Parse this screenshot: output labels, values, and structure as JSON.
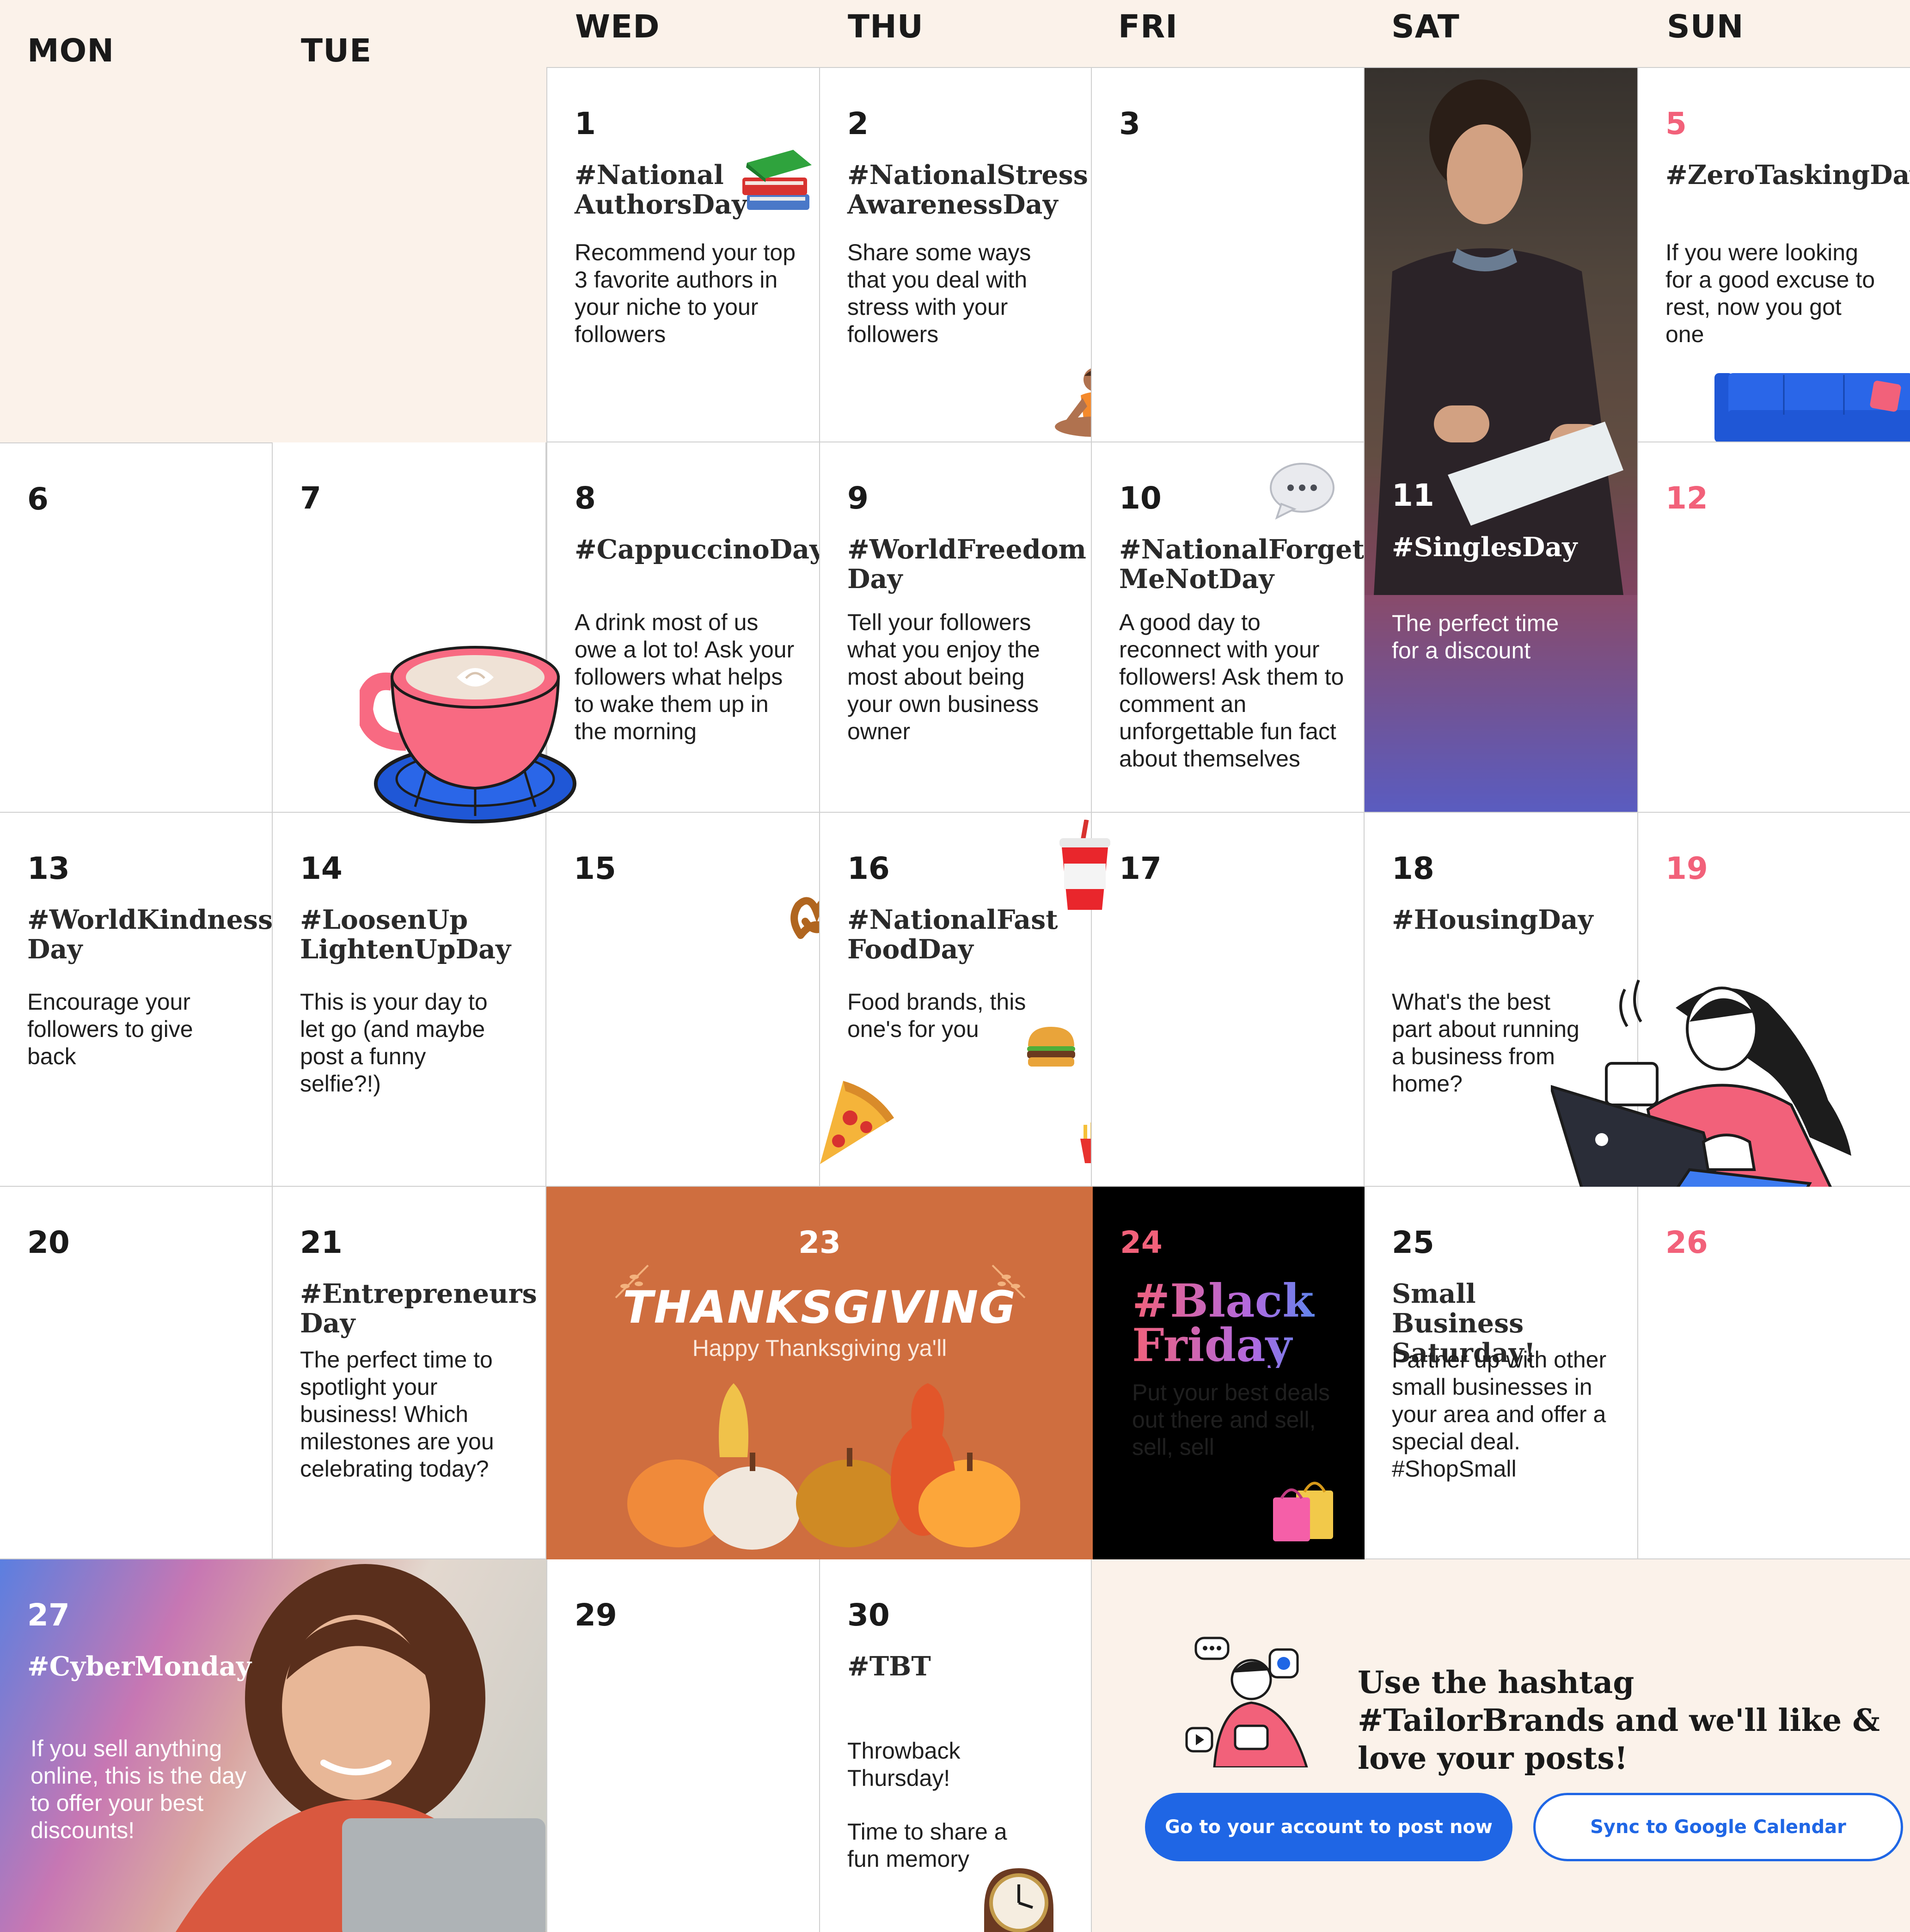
{
  "weekdays": [
    "MON",
    "TUE",
    "WED",
    "THU",
    "FRI",
    "SAT",
    "SUN"
  ],
  "days": {
    "d1": {
      "num": "1",
      "tag": "#National AuthorsDay",
      "desc": "Recommend your top 3 favorite authors in your niche to your followers",
      "icon": "books-icon"
    },
    "d2": {
      "num": "2",
      "tag": "#NationalStress AwarenessDay",
      "desc": "Share some ways that you deal with stress with your followers",
      "icon": "meditation-icon"
    },
    "d3": {
      "num": "3"
    },
    "d5": {
      "num": "5",
      "tag": "#ZeroTaskingDay",
      "desc": "If you were looking for a good excuse to rest, now you got one",
      "icon": "sofa-icon"
    },
    "d6": {
      "num": "6"
    },
    "d7": {
      "num": "7",
      "icon": "cappuccino-icon"
    },
    "d8": {
      "num": "8",
      "tag": "#CappuccinoDay",
      "desc": "A drink most of us owe a lot to! Ask your followers what helps to wake them up in the morning"
    },
    "d9": {
      "num": "9",
      "tag": "#WorldFreedom Day",
      "desc": "Tell your followers what you enjoy the most about being your own business owner"
    },
    "d10": {
      "num": "10",
      "tag": "#NationalForget MeNotDay",
      "desc": "A good day to reconnect with your followers! Ask them to comment an unforgettable fun fact about themselves",
      "icon": "speech-bubble-icon"
    },
    "d11": {
      "num": "11",
      "tag": "#SinglesDay",
      "desc": "The perfect time for a discount",
      "photo": "man-reading-letter-photo"
    },
    "d12": {
      "num": "12"
    },
    "d13": {
      "num": "13",
      "tag": "#WorldKindness Day",
      "desc": "Encourage your followers to give back"
    },
    "d14": {
      "num": "14",
      "tag": "#LoosenUp LightenUpDay",
      "desc": "This is your day to let go (and maybe post a funny selfie?!)"
    },
    "d15": {
      "num": "15",
      "icon": "pretzel-icon"
    },
    "d16": {
      "num": "16",
      "tag": "#NationalFast FoodDay",
      "desc": "Food brands, this one's for you",
      "icons": [
        "soda-cup-icon",
        "burger-icon",
        "pizza-icon",
        "fries-icon"
      ]
    },
    "d17": {
      "num": "17"
    },
    "d18": {
      "num": "18",
      "tag": "#HousingDay",
      "desc": "What's the best part about running a business from home?",
      "icon": "woman-with-laptop-icon"
    },
    "d19": {
      "num": "19"
    },
    "d20": {
      "num": "20"
    },
    "d21": {
      "num": "21",
      "tag": "#Entrepreneurs Day",
      "desc": "The perfect time to spotlight your business! Which milestones are you celebrating today?"
    },
    "d23": {
      "num": "23",
      "title": "THANKSGIVING",
      "sub": "Happy Thanksgiving ya'll",
      "icon": "pumpkins-icon"
    },
    "d24": {
      "num": "24",
      "tag": "#Black Friday",
      "desc": "Put your best deals out there and sell, sell, sell",
      "icon": "shopping-bags-icon"
    },
    "d25": {
      "num": "25",
      "tag": "Small Business Saturday!",
      "desc": "Partner up with other small businesses in your area and offer a special deal. #ShopSmall"
    },
    "d26": {
      "num": "26"
    },
    "d27": {
      "num": "27",
      "tag": "#CyberMonday",
      "desc": "If you sell anything online, this is the day to offer your best discounts!",
      "photo": "woman-smiling-photo"
    },
    "d29": {
      "num": "29"
    },
    "d30": {
      "num": "30",
      "tag": "#TBT",
      "desc1": "Throwback Thursday!",
      "desc2": "Time to share a fun memory",
      "icon": "clock-icon"
    }
  },
  "promo": {
    "headline": "Use the hashtag #TailorBrands and we'll like & love your posts!",
    "btn_primary": "Go to your account to post now",
    "btn_secondary": "Sync to Google Calendar",
    "icon": "social-person-icon"
  },
  "colors": {
    "header_bg": "#fbf2ea",
    "pink": "#f2617a",
    "thanksgiving_bg": "#cf6e3f",
    "black_friday_bg": "#000000",
    "button_blue": "#1f66e5"
  }
}
